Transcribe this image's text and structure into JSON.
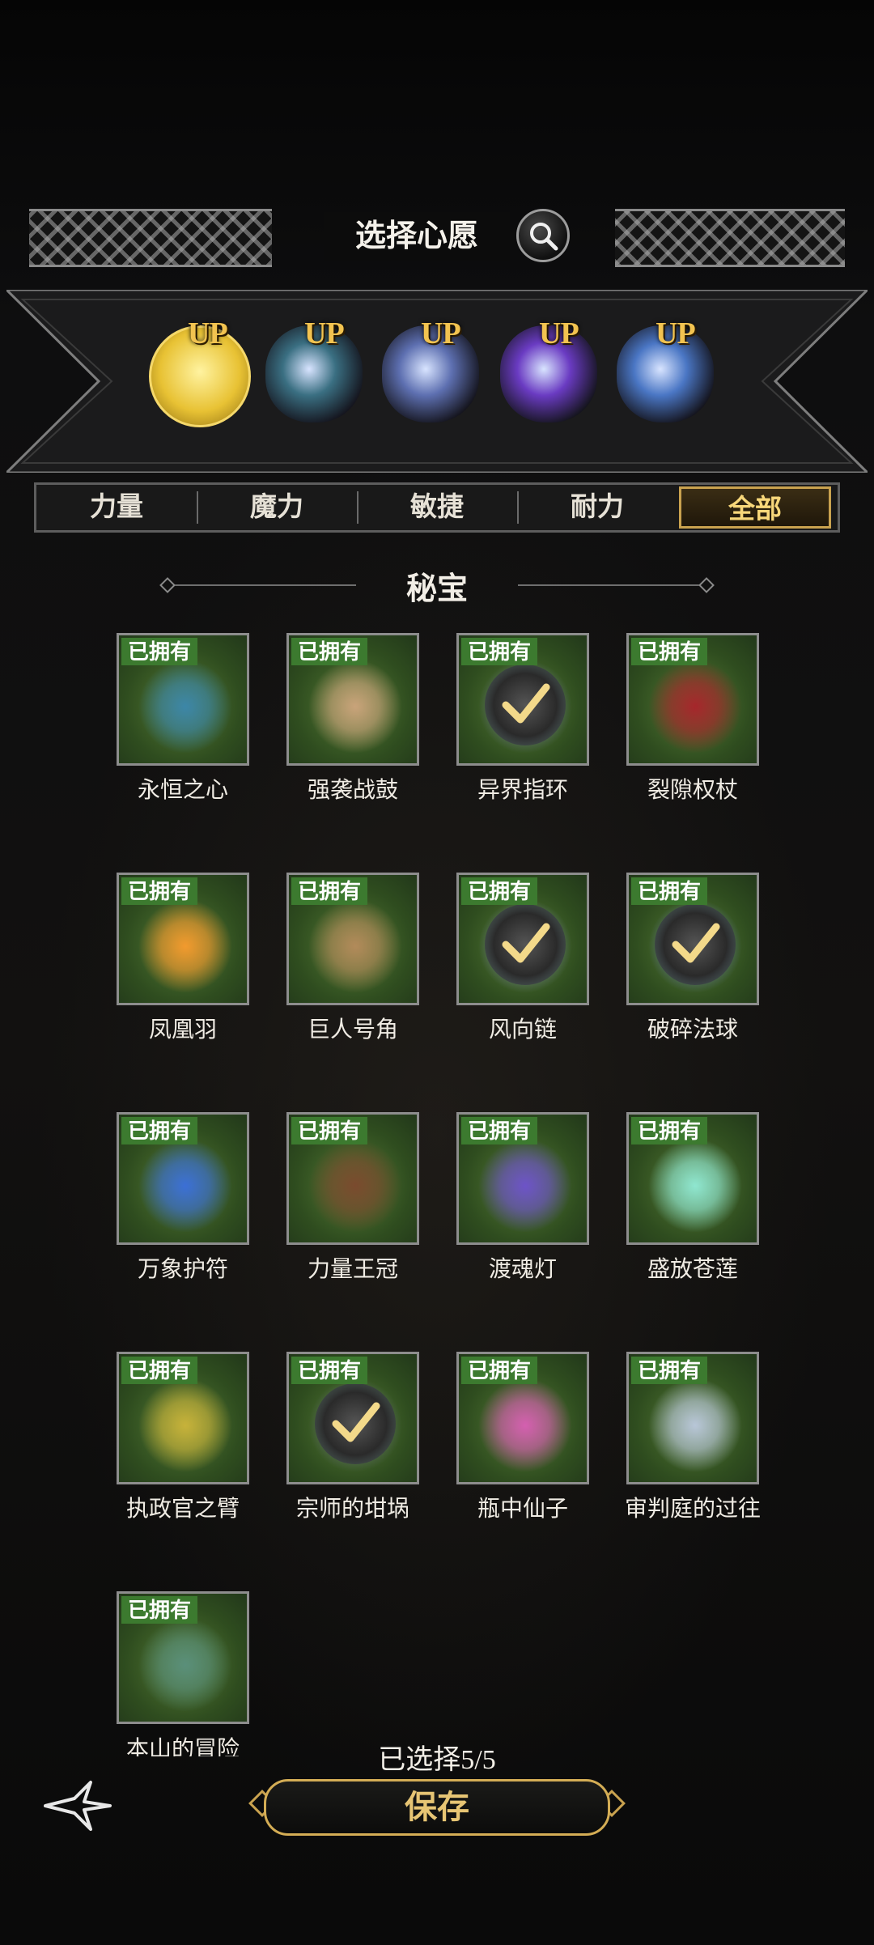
{
  "header": {
    "title": "选择心愿"
  },
  "up_banner": {
    "up_label": "UP",
    "items": [
      {
        "name": "golden-figure-avatar",
        "color": "#e8c234"
      },
      {
        "name": "dark-ring",
        "color": "#3a6f82"
      },
      {
        "name": "silver-pendant",
        "color": "#5d6fb0"
      },
      {
        "name": "purple-orb",
        "color": "#6a3bc2"
      },
      {
        "name": "cauldron",
        "color": "#4a76c4"
      }
    ]
  },
  "tabs": [
    {
      "label": "力量",
      "active": false
    },
    {
      "label": "魔力",
      "active": false
    },
    {
      "label": "敏捷",
      "active": false
    },
    {
      "label": "耐力",
      "active": false
    },
    {
      "label": "全部",
      "active": true
    }
  ],
  "section": {
    "title": "秘宝"
  },
  "owned_label": "已拥有",
  "items": [
    {
      "name": "永恒之心",
      "owned": true,
      "selected": false,
      "color": "#3c86a8"
    },
    {
      "name": "强袭战鼓",
      "owned": true,
      "selected": false,
      "color": "#c9a37a"
    },
    {
      "name": "异界指环",
      "owned": true,
      "selected": true,
      "color": "#6f7a96"
    },
    {
      "name": "裂隙权杖",
      "owned": true,
      "selected": false,
      "color": "#a6262b"
    },
    {
      "name": "凤凰羽",
      "owned": true,
      "selected": false,
      "color": "#f29a2e"
    },
    {
      "name": "巨人号角",
      "owned": true,
      "selected": false,
      "color": "#b28a5a"
    },
    {
      "name": "风向链",
      "owned": true,
      "selected": true,
      "color": "#7d8aa6"
    },
    {
      "name": "破碎法球",
      "owned": true,
      "selected": true,
      "color": "#6c7fb0"
    },
    {
      "name": "万象护符",
      "owned": true,
      "selected": false,
      "color": "#3b6fd6"
    },
    {
      "name": "力量王冠",
      "owned": true,
      "selected": false,
      "color": "#7a4a2e"
    },
    {
      "name": "渡魂灯",
      "owned": true,
      "selected": false,
      "color": "#6d53c8"
    },
    {
      "name": "盛放苍莲",
      "owned": true,
      "selected": false,
      "color": "#8fe6d0"
    },
    {
      "name": "执政官之臂",
      "owned": true,
      "selected": false,
      "color": "#c7b23a"
    },
    {
      "name": "宗师的坩埚",
      "owned": true,
      "selected": true,
      "color": "#66707a"
    },
    {
      "name": "瓶中仙子",
      "owned": true,
      "selected": false,
      "color": "#d45fb0"
    },
    {
      "name": "审判庭的过往",
      "owned": true,
      "selected": false,
      "color": "#b8c6d8"
    },
    {
      "name": "本山的冒险",
      "owned": true,
      "selected": false,
      "color": "#5a8f7a"
    }
  ],
  "footer": {
    "selected_text": "已选择5/5",
    "save_label": "保存"
  }
}
